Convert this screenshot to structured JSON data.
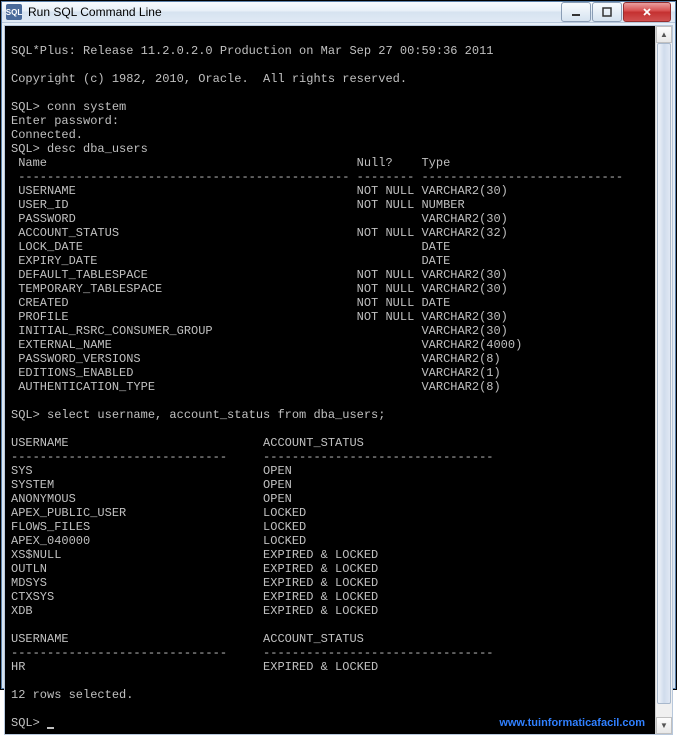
{
  "window": {
    "title": "Run SQL Command Line",
    "icon_label": "SQL"
  },
  "terminal": {
    "banner": "SQL*Plus: Release 11.2.0.2.0 Production on Mar Sep 27 00:59:36 2011",
    "copyright": "Copyright (c) 1982, 2010, Oracle.  All rights reserved.",
    "prompt1": "SQL> conn system",
    "enter_pw": "Enter password:",
    "connected": "Connected.",
    "prompt2": "SQL> desc dba_users",
    "desc_header_name": " Name",
    "desc_header_null": "Null?",
    "desc_header_type": "Type",
    "desc_rows": [
      {
        "name": "USERNAME",
        "null": "NOT NULL",
        "type": "VARCHAR2(30)"
      },
      {
        "name": "USER_ID",
        "null": "NOT NULL",
        "type": "NUMBER"
      },
      {
        "name": "PASSWORD",
        "null": "",
        "type": "VARCHAR2(30)"
      },
      {
        "name": "ACCOUNT_STATUS",
        "null": "NOT NULL",
        "type": "VARCHAR2(32)"
      },
      {
        "name": "LOCK_DATE",
        "null": "",
        "type": "DATE"
      },
      {
        "name": "EXPIRY_DATE",
        "null": "",
        "type": "DATE"
      },
      {
        "name": "DEFAULT_TABLESPACE",
        "null": "NOT NULL",
        "type": "VARCHAR2(30)"
      },
      {
        "name": "TEMPORARY_TABLESPACE",
        "null": "NOT NULL",
        "type": "VARCHAR2(30)"
      },
      {
        "name": "CREATED",
        "null": "NOT NULL",
        "type": "DATE"
      },
      {
        "name": "PROFILE",
        "null": "NOT NULL",
        "type": "VARCHAR2(30)"
      },
      {
        "name": "INITIAL_RSRC_CONSUMER_GROUP",
        "null": "",
        "type": "VARCHAR2(30)"
      },
      {
        "name": "EXTERNAL_NAME",
        "null": "",
        "type": "VARCHAR2(4000)"
      },
      {
        "name": "PASSWORD_VERSIONS",
        "null": "",
        "type": "VARCHAR2(8)"
      },
      {
        "name": "EDITIONS_ENABLED",
        "null": "",
        "type": "VARCHAR2(1)"
      },
      {
        "name": "AUTHENTICATION_TYPE",
        "null": "",
        "type": "VARCHAR2(8)"
      }
    ],
    "prompt3": "SQL> select username, account_status from dba_users;",
    "select_header_user": "USERNAME",
    "select_header_status": "ACCOUNT_STATUS",
    "select_rows": [
      {
        "user": "SYS",
        "status": "OPEN"
      },
      {
        "user": "SYSTEM",
        "status": "OPEN"
      },
      {
        "user": "ANONYMOUS",
        "status": "OPEN"
      },
      {
        "user": "APEX_PUBLIC_USER",
        "status": "LOCKED"
      },
      {
        "user": "FLOWS_FILES",
        "status": "LOCKED"
      },
      {
        "user": "APEX_040000",
        "status": "LOCKED"
      },
      {
        "user": "XS$NULL",
        "status": "EXPIRED & LOCKED"
      },
      {
        "user": "OUTLN",
        "status": "EXPIRED & LOCKED"
      },
      {
        "user": "MDSYS",
        "status": "EXPIRED & LOCKED"
      },
      {
        "user": "CTXSYS",
        "status": "EXPIRED & LOCKED"
      },
      {
        "user": "XDB",
        "status": "EXPIRED & LOCKED"
      }
    ],
    "select_rows2": [
      {
        "user": "HR",
        "status": "EXPIRED & LOCKED"
      }
    ],
    "rows_selected": "12 rows selected.",
    "prompt4": "SQL> ",
    "watermark": "www.tuinformaticafacil.com"
  }
}
